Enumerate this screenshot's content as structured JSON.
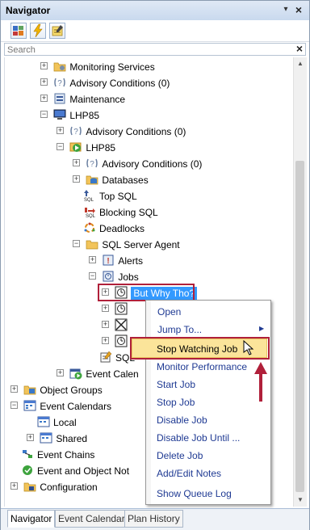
{
  "panel": {
    "title": "Navigator"
  },
  "toolbar": {
    "buttons": [
      "objects-icon",
      "lightning-icon",
      "notes-icon"
    ]
  },
  "search": {
    "placeholder": "Search"
  },
  "tree": {
    "items": [
      {
        "label": "Monitoring Services",
        "icon": "folder-gear-icon"
      },
      {
        "label": "Advisory Conditions (0)",
        "icon": "advisory-icon"
      },
      {
        "label": "Maintenance",
        "icon": "maintenance-icon"
      },
      {
        "label": "LHP85",
        "icon": "computer-icon"
      },
      {
        "label": "Advisory Conditions (0)",
        "icon": "advisory-icon"
      },
      {
        "label": "LHP85",
        "icon": "sql-server-icon"
      },
      {
        "label": "Advisory Conditions (0)",
        "icon": "advisory-icon"
      },
      {
        "label": "Databases",
        "icon": "databases-icon"
      },
      {
        "label": "Top SQL",
        "icon": "top-sql-icon"
      },
      {
        "label": "Blocking SQL",
        "icon": "blocking-sql-icon"
      },
      {
        "label": "Deadlocks",
        "icon": "deadlocks-icon"
      },
      {
        "label": "SQL Server Agent",
        "icon": "folder-icon"
      },
      {
        "label": "Alerts",
        "icon": "alerts-icon"
      },
      {
        "label": "Jobs",
        "icon": "jobs-icon"
      },
      {
        "label": "But Why Tho?",
        "icon": "clock-icon"
      },
      {
        "label": "SQL",
        "icon": "sql-notes-icon"
      },
      {
        "label": "Event Calen",
        "icon": "event-calendar-icon"
      },
      {
        "label": "Object Groups",
        "icon": "object-groups-icon"
      },
      {
        "label": "Event Calendars",
        "icon": "event-calendars-icon"
      },
      {
        "label": "Local",
        "icon": "local-icon"
      },
      {
        "label": "Shared",
        "icon": "shared-icon"
      },
      {
        "label": "Event Chains",
        "icon": "event-chains-icon"
      },
      {
        "label": "Event and Object Not",
        "icon": "event-object-notification-icon"
      },
      {
        "label": "Configuration",
        "icon": "configuration-icon"
      }
    ]
  },
  "context_menu": {
    "items": [
      "Open",
      "Jump To...",
      "Stop Watching Job",
      "Monitor Performance",
      "Start Job",
      "Stop Job",
      "Disable Job",
      "Disable Job Until ...",
      "Delete Job",
      "Add/Edit Notes",
      "Show Queue Log"
    ],
    "highlighted": "Stop Watching Job"
  },
  "tabs": [
    "Navigator",
    "Event Calendar",
    "Plan History"
  ],
  "colors": {
    "selection": "#3399ff",
    "highlight": "#fbe49a",
    "annotation": "#b0203a"
  }
}
